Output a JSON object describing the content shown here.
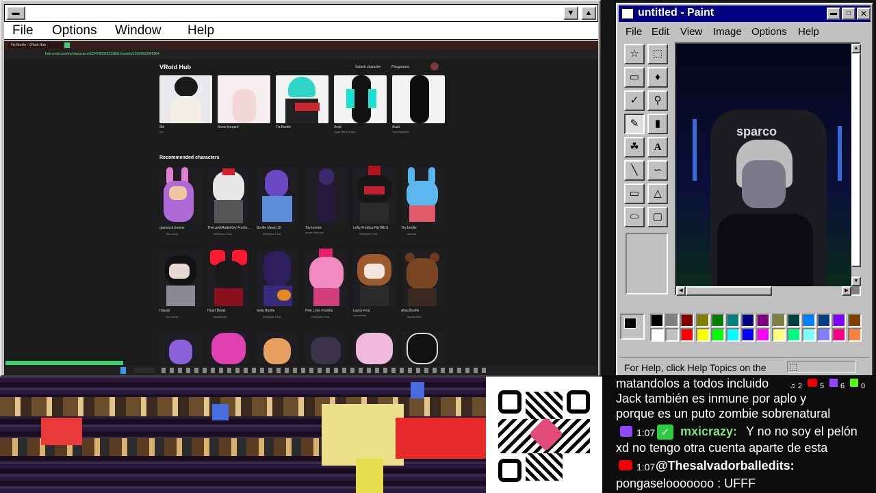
{
  "retro_window": {
    "menu": [
      "File",
      "Options",
      "Window",
      "Help"
    ]
  },
  "browser": {
    "tab_title": "Fiz Bonfie - VRoid Hub",
    "url": "hub.vroid.com/en/characters/5324790023223851/models/12991612345804",
    "site_name": "VRoid Hub",
    "header_links": [
      "Submit character",
      "Playground"
    ],
    "top_characters": [
      {
        "name": "Shi",
        "sub": "Shi"
      },
      {
        "name": "Snow leopard",
        "sub": ""
      },
      {
        "name": "Fiz Bonfie",
        "sub": ""
      },
      {
        "name": "Avali",
        "sub": "Cyan (Blue) Avali"
      },
      {
        "name": "Avali",
        "sub": "Void Rabbitee"
      }
    ],
    "recommended_title": "Recommended characters",
    "recommended_row1": [
      {
        "name": "glamrock bonnie",
        "author": "Your snow"
      },
      {
        "name": "TheLambRadioKey Fredin...",
        "author": "DrillSpike Fera"
      },
      {
        "name": "Bonfie Messi 10",
        "author": "DrillSpike Fera"
      },
      {
        "name": "Toy bonnie",
        "author": "bonfie with ball"
      },
      {
        "name": "Lefty Fredina PigTAILS",
        "author": "DrillSpike Fera"
      },
      {
        "name": "Toy bonfie",
        "author": "shrome"
      }
    ],
    "recommended_row2": [
      {
        "name": "Hasaki",
        "author": "Your snow"
      },
      {
        "name": "Heart Break",
        "author": "Bloodsmith"
      },
      {
        "name": "Gotu Bonfie",
        "author": "DrillSpike Fera"
      },
      {
        "name": "Pink Love Fredina",
        "author": "DrillSpike Fera"
      },
      {
        "name": "Laura Fera",
        "author": "LauraMoth"
      },
      {
        "name": "Alisa Bonfie",
        "author": "NeoArmbot"
      }
    ]
  },
  "paint": {
    "title": "untitled - Paint",
    "menu": [
      "File",
      "Edit",
      "View",
      "Image",
      "Options",
      "Help"
    ],
    "status": "For Help, click Help Topics on the",
    "avatar_chair_brand": "sparco",
    "palette": [
      "#000000",
      "#808080",
      "#800000",
      "#808000",
      "#008000",
      "#008080",
      "#000080",
      "#800080",
      "#808040",
      "#004040",
      "#0080ff",
      "#004080",
      "#8000ff",
      "#804000",
      "#ffffff",
      "#c0c0c0",
      "#ff0000",
      "#ffff00",
      "#00ff00",
      "#00ffff",
      "#0000ff",
      "#ff00ff",
      "#ffff80",
      "#00ff80",
      "#80ffff",
      "#8080ff",
      "#ff0080",
      "#ff8040"
    ]
  },
  "chat": {
    "lines": [
      {
        "text": "matandolos a todos incluido",
        "user": "",
        "platform": ""
      },
      {
        "text": "Jack también es inmune por aplo y",
        "user": "",
        "platform": ""
      },
      {
        "text": "porque es un puto zombie sobrenatural",
        "user": "",
        "platform": ""
      },
      {
        "text": "Y no no soy el pelón",
        "user": "mxicrazy:",
        "time": "1:07",
        "platform": "twitch"
      },
      {
        "text": "xd no tengo otra cuenta aparte de esta",
        "user": "",
        "platform": ""
      },
      {
        "text": "",
        "user": "@Thesalvadorballedits:",
        "time": "1:07",
        "platform": "youtube"
      },
      {
        "text": "pongaselooooooo : UFFF",
        "user": "",
        "platform": ""
      }
    ],
    "counters": [
      "2",
      "5",
      "6",
      "0"
    ]
  }
}
